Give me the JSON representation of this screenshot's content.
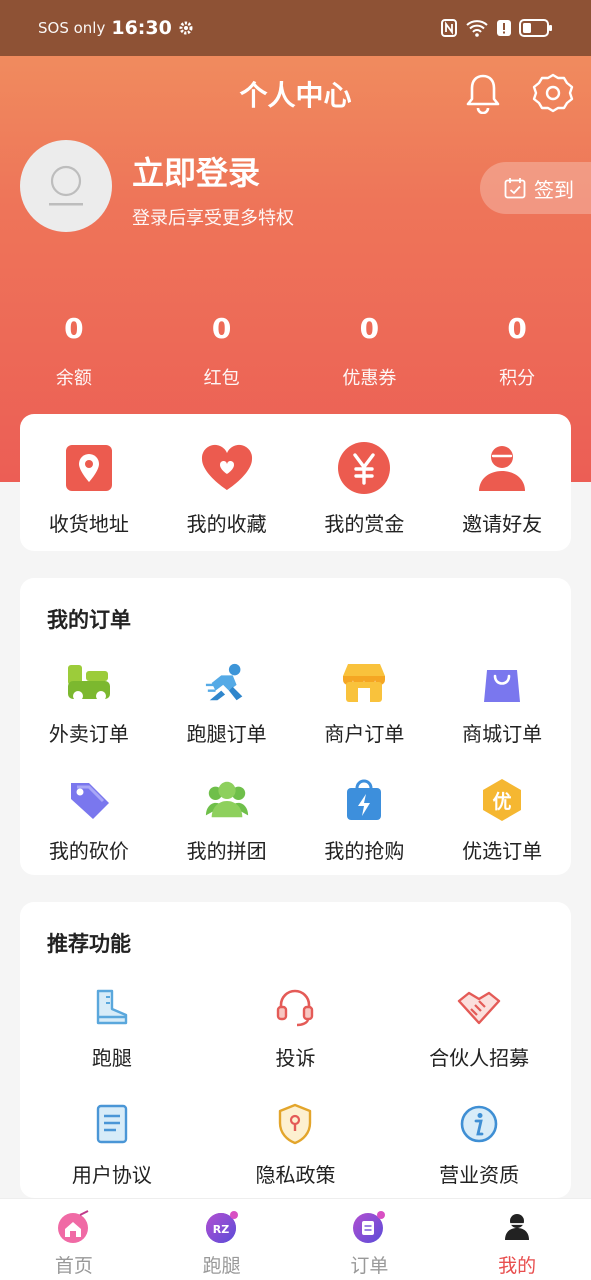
{
  "status_bar": {
    "carrier": "SOS only",
    "time": "16:30"
  },
  "header": {
    "title": "个人中心"
  },
  "profile": {
    "login_title": "立即登录",
    "login_subtitle": "登录后享受更多特权",
    "signin_label": "签到"
  },
  "stats": [
    {
      "value": "0",
      "label": "余额"
    },
    {
      "value": "0",
      "label": "红包"
    },
    {
      "value": "0",
      "label": "优惠券"
    },
    {
      "value": "0",
      "label": "积分"
    }
  ],
  "quick_actions": [
    {
      "label": "收货地址",
      "icon": "location-pin-icon"
    },
    {
      "label": "我的收藏",
      "icon": "heart-icon"
    },
    {
      "label": "我的赏金",
      "icon": "yen-icon"
    },
    {
      "label": "邀请好友",
      "icon": "person-icon"
    }
  ],
  "orders": {
    "title": "我的订单",
    "items": [
      {
        "label": "外卖订单",
        "icon": "takeout-icon"
      },
      {
        "label": "跑腿订单",
        "icon": "runner-icon"
      },
      {
        "label": "商户订单",
        "icon": "store-icon"
      },
      {
        "label": "商城订单",
        "icon": "shopping-bag-icon"
      },
      {
        "label": "我的砍价",
        "icon": "price-tag-icon"
      },
      {
        "label": "我的拼团",
        "icon": "group-icon"
      },
      {
        "label": "我的抢购",
        "icon": "flash-sale-icon"
      },
      {
        "label": "优选订单",
        "icon": "preferred-badge-icon"
      }
    ]
  },
  "recommended": {
    "title": "推荐功能",
    "items": [
      {
        "label": "跑腿",
        "icon": "boot-icon"
      },
      {
        "label": "投诉",
        "icon": "headset-icon"
      },
      {
        "label": "合伙人招募",
        "icon": "handshake-icon"
      },
      {
        "label": "用户协议",
        "icon": "document-icon"
      },
      {
        "label": "隐私政策",
        "icon": "shield-icon"
      },
      {
        "label": "营业资质",
        "icon": "info-icon"
      }
    ]
  },
  "bottom_nav": [
    {
      "label": "首页",
      "icon": "home-icon",
      "active": false
    },
    {
      "label": "跑腿",
      "icon": "errand-icon",
      "active": false
    },
    {
      "label": "订单",
      "icon": "orders-icon",
      "active": false
    },
    {
      "label": "我的",
      "icon": "user-icon",
      "active": true
    }
  ],
  "colors": {
    "accent": "#e84e4e",
    "header_top": "#f08b5e",
    "header_bottom": "#ec5e55"
  }
}
